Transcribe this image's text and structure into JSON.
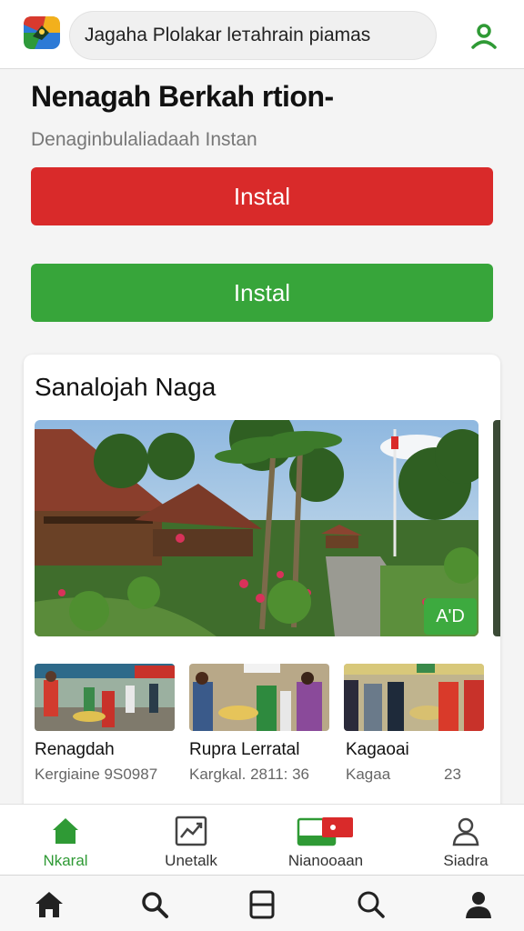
{
  "header": {
    "search_text": "Jagaha Plolakar leтahrain piamas"
  },
  "hero": {
    "title": "Nenagah Berkah rtion-",
    "subtitle": "Denaginbulaliadaah Instan",
    "install_red_label": "Instal",
    "install_green_label": "Instal"
  },
  "card": {
    "title": "Sanalojah Naga",
    "ad_badge": "A'D",
    "items": [
      {
        "name": "Renagdah",
        "meta": "Kergiaine 9S0987"
      },
      {
        "name": "Rupra Lerratal",
        "meta": "Kargkal. 2811: 36"
      },
      {
        "name": "Kagaoai",
        "meta": "Kagaa",
        "num": "23"
      }
    ]
  },
  "bottom_nav": {
    "items": [
      {
        "label": "Nkaral",
        "icon": "home-icon",
        "active": true
      },
      {
        "label": "Unetalk",
        "icon": "chart-icon",
        "active": false
      },
      {
        "label": "Nianooaan",
        "icon": "flag-card-icon",
        "active": false
      },
      {
        "label": "Siadra",
        "icon": "person-icon",
        "active": false
      }
    ]
  },
  "system_nav": {
    "icons": [
      "home-icon",
      "search-icon",
      "tabs-icon",
      "search-icon",
      "person-icon"
    ]
  },
  "colors": {
    "red": "#d92a2a",
    "green": "#37a53a",
    "active_nav": "#2f9a35"
  }
}
